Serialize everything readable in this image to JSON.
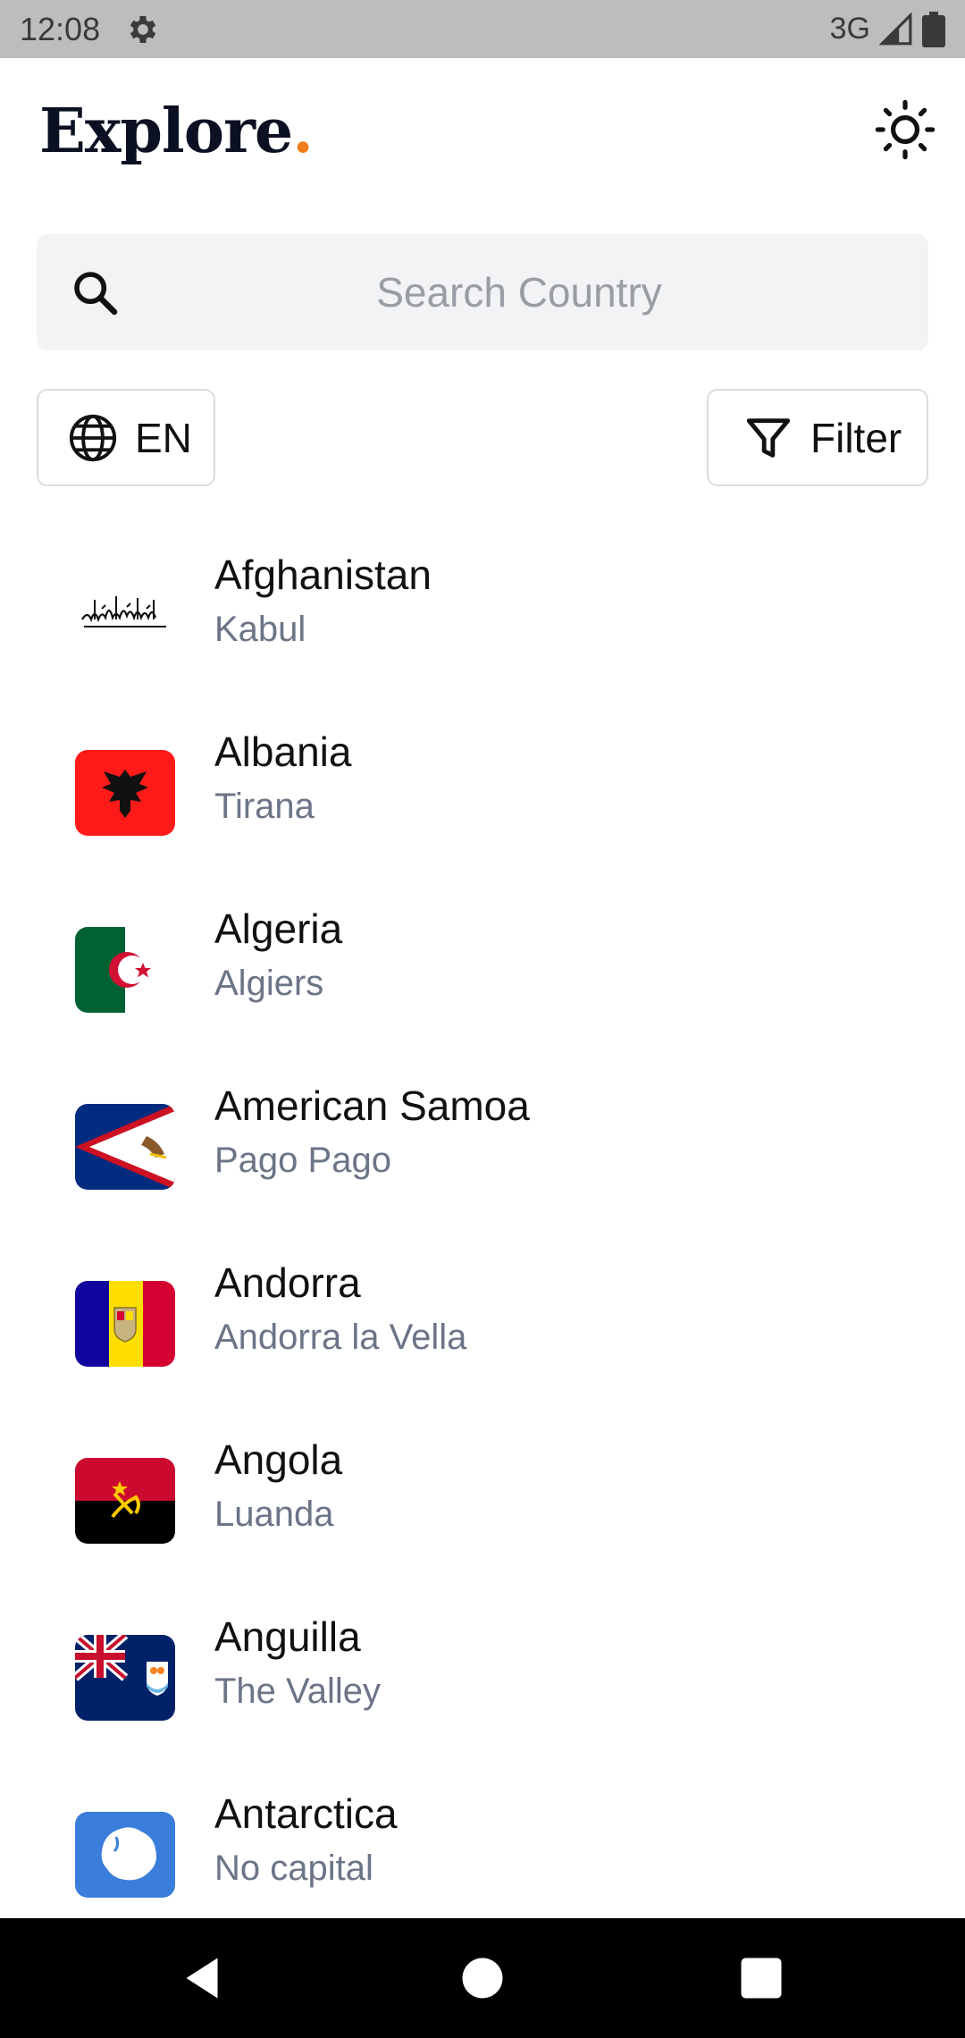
{
  "status_bar": {
    "time": "12:08",
    "network": "3G"
  },
  "header": {
    "logo_text": "Explore",
    "logo_dot": ".",
    "accent": "#f07b18"
  },
  "search": {
    "placeholder": "Search Country",
    "value": ""
  },
  "language_button": {
    "label": "EN"
  },
  "filter_button": {
    "label": "Filter"
  },
  "countries": [
    {
      "name": "Afghanistan",
      "capital": "Kabul",
      "flag": "afghanistan-flag-icon"
    },
    {
      "name": "Albania",
      "capital": "Tirana",
      "flag": "albania-flag-icon"
    },
    {
      "name": "Algeria",
      "capital": "Algiers",
      "flag": "algeria-flag-icon"
    },
    {
      "name": "American Samoa",
      "capital": "Pago Pago",
      "flag": "american-samoa-flag-icon"
    },
    {
      "name": "Andorra",
      "capital": "Andorra la Vella",
      "flag": "andorra-flag-icon"
    },
    {
      "name": "Angola",
      "capital": "Luanda",
      "flag": "angola-flag-icon"
    },
    {
      "name": "Anguilla",
      "capital": "The Valley",
      "flag": "anguilla-flag-icon"
    },
    {
      "name": "Antarctica",
      "capital": "No capital",
      "flag": "antarctica-flag-icon"
    }
  ],
  "icons": {
    "status": [
      "gear-icon",
      "signal-icon",
      "battery-icon"
    ],
    "header": [
      "sun-icon"
    ],
    "search": "search-icon",
    "language": "globe-icon",
    "filter": "filter-icon",
    "nav": [
      "back-icon",
      "home-icon",
      "recents-icon"
    ]
  }
}
